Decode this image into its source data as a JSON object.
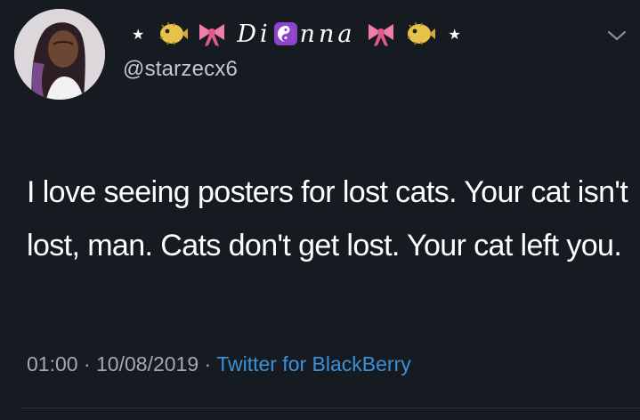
{
  "user": {
    "display_name_start": "Di",
    "display_name_end": "nna",
    "handle": "@starzecx6",
    "stars": [
      "★",
      "★"
    ]
  },
  "tweet": {
    "text": "I love seeing posters for lost cats. Your cat isn't lost, man. Cats don't get lost. Your cat left you.",
    "time": "01:00",
    "separator": "·",
    "date": "10/08/2019",
    "source": "Twitter for BlackBerry"
  },
  "icons": {
    "left_emojis": [
      "blowfish-icon",
      "ribbon-icon"
    ],
    "right_emojis": [
      "ribbon-icon",
      "blowfish-icon"
    ],
    "name_inset": "yin-yang-icon",
    "menu": "chevron-down-icon"
  },
  "colors": {
    "background": "#161b22",
    "text": "#ffffff",
    "secondary": "#a3a9b0",
    "link": "#3d8fd8",
    "ribbon": "#f07fa6",
    "blowfish": "#e7c24a",
    "yin_yang_bg": "#8e44c8"
  }
}
